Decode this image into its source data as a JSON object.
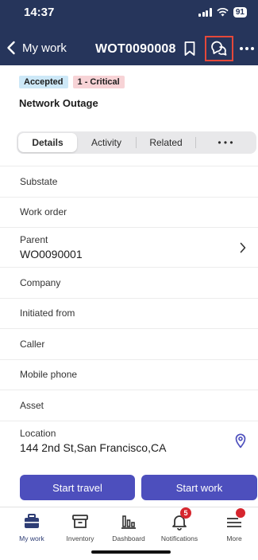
{
  "status_bar": {
    "time": "14:37",
    "battery": "91"
  },
  "nav": {
    "back_label": "My work",
    "title": "WOT0090008"
  },
  "record": {
    "state_badge": "Accepted",
    "priority_badge": "1 - Critical",
    "title": "Network Outage"
  },
  "tabs": [
    {
      "label": "Details",
      "active": true
    },
    {
      "label": "Activity",
      "active": false
    },
    {
      "label": "Related",
      "active": false
    },
    {
      "label": "• • •",
      "active": false
    }
  ],
  "fields": {
    "substate": {
      "label": "Substate"
    },
    "work_order": {
      "label": "Work order"
    },
    "parent": {
      "label": "Parent",
      "value": "WO0090001"
    },
    "company": {
      "label": "Company"
    },
    "initiated_from": {
      "label": "Initiated from"
    },
    "caller": {
      "label": "Caller"
    },
    "mobile_phone": {
      "label": "Mobile phone"
    },
    "asset": {
      "label": "Asset"
    },
    "location": {
      "label": "Location",
      "value": "144 2nd St,San Francisco,CA"
    }
  },
  "actions": {
    "start_travel": "Start travel",
    "start_work": "Start work"
  },
  "bottom_nav": {
    "my_work": "My work",
    "inventory": "Inventory",
    "dashboard": "Dashboard",
    "notifications": "Notifications",
    "notifications_count": "5",
    "more": "More"
  },
  "colors": {
    "header": "#26355b",
    "accent": "#4d4fbd",
    "highlight_box": "#e5483a",
    "badge_red": "#d6262e",
    "accepted_badge": "#cde8f7",
    "critical_badge": "#f7d3d6"
  }
}
